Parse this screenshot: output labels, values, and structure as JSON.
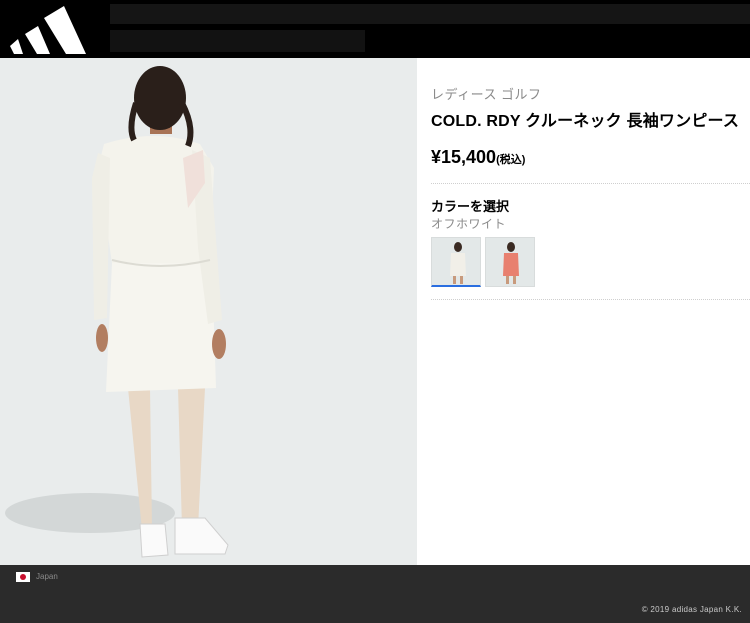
{
  "header": {
    "logo_icon": "adidas-badge-of-sport-icon"
  },
  "product": {
    "category": "レディース ゴルフ",
    "title": "COLD. RDY クルーネック 長袖ワンピース",
    "price": "¥15,400",
    "tax_note": "(税込)",
    "color_heading": "カラーを選択",
    "selected_color": "オフホワイト",
    "swatches": [
      {
        "color": "#f1efe8",
        "selected": true
      },
      {
        "color": "#e8806f",
        "selected": false
      }
    ]
  },
  "footer": {
    "country": "Japan",
    "copyright": "© 2019 adidas Japan K.K."
  }
}
